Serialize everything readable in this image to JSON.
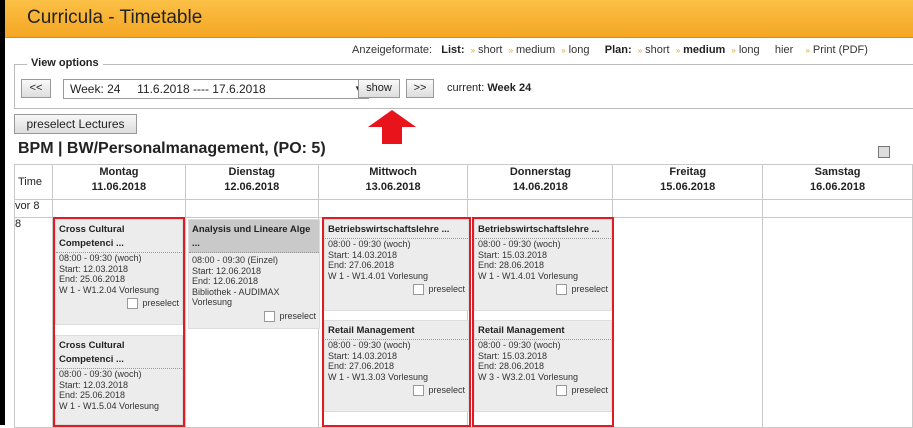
{
  "title": "Curricula - Timetable",
  "formats": {
    "label": "Anzeigeformate:",
    "list_label": "List:",
    "list_items": [
      "short",
      "medium",
      "long"
    ],
    "plan_label": "Plan:",
    "plan_items": [
      "short",
      "medium",
      "long"
    ],
    "extra": [
      "hier",
      "Print (PDF)"
    ]
  },
  "view_options": {
    "legend": "View options",
    "prev": "<<",
    "week_select": "Week: 24     11.6.2018 ---- 17.6.2018",
    "show": "show",
    "next": ">>",
    "current_label": "current:",
    "current_week": "Week 24"
  },
  "preselect_button": "preselect Lectures",
  "heading": "BPM | BW/Personalmanagement, (PO: 5)",
  "table": {
    "time_header": "Time",
    "days": [
      {
        "name": "Montag",
        "date": "11.06.2018"
      },
      {
        "name": "Dienstag",
        "date": "12.06.2018"
      },
      {
        "name": "Mittwoch",
        "date": "13.06.2018"
      },
      {
        "name": "Donnerstag",
        "date": "14.06.2018"
      },
      {
        "name": "Freitag",
        "date": "15.06.2018"
      },
      {
        "name": "Samstag",
        "date": "16.06.2018"
      }
    ],
    "rows": [
      "vor 8",
      "8"
    ]
  },
  "events": {
    "mon1": {
      "title1": "Cross Cultural",
      "title2": "Competenci ...",
      "time": "08:00 - 09:30 (woch)",
      "start": "Start:  12.03.2018",
      "end": "End:  25.06.2018",
      "room": "W 1 - W1.2.04  Vorlesung",
      "pre": "preselect"
    },
    "mon2": {
      "title1": "Cross Cultural",
      "title2": "Competenci ...",
      "time": "08:00 - 09:30 (woch)",
      "start": "Start:  12.03.2018",
      "end": "End:  25.06.2018",
      "room": "W 1 - W1.5.04  Vorlesung"
    },
    "tue1": {
      "title1": "Analysis und Lineare Alge",
      "title2": "...",
      "time": "08:00 - 09:30 (Einzel)",
      "start": "Start:  12.06.2018",
      "end": "End:  12.06.2018",
      "room": "Bibliothek - AUDIMAX",
      "room2": "Vorlesung",
      "pre": "preselect"
    },
    "wed1": {
      "title1": "Betriebswirtschaftslehre ...",
      "time": "08:00 - 09:30 (woch)",
      "start": "Start:  14.03.2018",
      "end": "End:  27.06.2018",
      "room": "W 1 - W1.4.01  Vorlesung",
      "pre": "preselect"
    },
    "wed2": {
      "title1": "Retail Management",
      "time": "08:00 - 09:30 (woch)",
      "start": "Start:  14.03.2018",
      "end": "End:  27.06.2018",
      "room": "W 1 - W1.3.03  Vorlesung",
      "pre": "preselect"
    },
    "thu1": {
      "title1": "Betriebswirtschaftslehre ...",
      "time": "08:00 - 09:30 (woch)",
      "start": "Start:  15.03.2018",
      "end": "End:  28.06.2018",
      "room": "W 1 - W1.4.01  Vorlesung",
      "pre": "preselect"
    },
    "thu2": {
      "title1": "Retail Management",
      "time": "08:00 - 09:30 (woch)",
      "start": "Start:  15.03.2018",
      "end": "End:  28.06.2018",
      "room": "W 3 - W3.2.01  Vorlesung",
      "pre": "preselect"
    }
  },
  "colors": {
    "title_bar": "#f5a623",
    "highlight": "#e01b24",
    "arrow": "#e8131b"
  }
}
